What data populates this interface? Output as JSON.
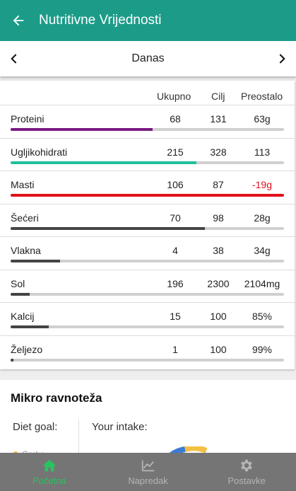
{
  "header": {
    "title": "Nutritivne Vrijednosti",
    "back_icon": "arrow-left-icon"
  },
  "day_nav": {
    "label": "Danas",
    "prev_icon": "chevron-left-icon",
    "next_icon": "chevron-right-icon"
  },
  "table": {
    "columns": [
      "Ukupno",
      "Cilj",
      "Preostalo"
    ],
    "rows": [
      {
        "name": "Proteini",
        "total": "68",
        "goal": "131",
        "remaining": "63g",
        "progress": 0.52,
        "bar_color": "#7b1a82",
        "remaining_color": "#222222"
      },
      {
        "name": "Ugljikohidrati",
        "total": "215",
        "goal": "328",
        "remaining": "113",
        "progress": 0.68,
        "bar_color": "#1fc09c",
        "remaining_color": "#222222"
      },
      {
        "name": "Masti",
        "total": "106",
        "goal": "87",
        "remaining": "-19g",
        "progress": 1.0,
        "bar_color": "#e0101b",
        "remaining_color": "#e0101b"
      },
      {
        "name": "Šećeri",
        "total": "70",
        "goal": "98",
        "remaining": "28g",
        "progress": 0.71,
        "bar_color": "#444444",
        "remaining_color": "#222222"
      },
      {
        "name": "Vlakna",
        "total": "4",
        "goal": "38",
        "remaining": "34g",
        "progress": 0.18,
        "bar_color": "#444444",
        "remaining_color": "#222222"
      },
      {
        "name": "Sol",
        "total": "196",
        "goal": "2300",
        "remaining": "2104mg",
        "progress": 0.07,
        "bar_color": "#444444",
        "remaining_color": "#222222"
      },
      {
        "name": "Kalcij",
        "total": "15",
        "goal": "100",
        "remaining": "85%",
        "progress": 0.14,
        "bar_color": "#444444",
        "remaining_color": "#222222"
      },
      {
        "name": "Željezo",
        "total": "1",
        "goal": "100",
        "remaining": "99%",
        "progress": 0.01,
        "bar_color": "#444444",
        "remaining_color": "#222222"
      }
    ]
  },
  "micro": {
    "title": "Mikro ravnoteža",
    "diet_goal_label": "Diet goal:",
    "intake_label": "Your intake:",
    "legend_partial": "Carbs",
    "legend_color": "#f4c043"
  },
  "bottom_nav": {
    "tabs": [
      {
        "label": "Početna",
        "icon": "home-icon",
        "active": true
      },
      {
        "label": "Napredak",
        "icon": "chart-icon",
        "active": false
      },
      {
        "label": "Postavke",
        "icon": "gear-icon",
        "active": false
      }
    ]
  }
}
